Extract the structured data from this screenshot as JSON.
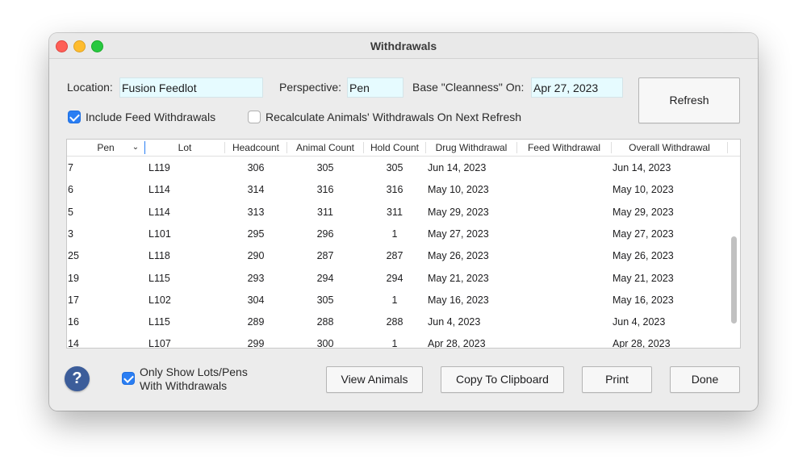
{
  "window": {
    "title": "Withdrawals"
  },
  "filters": {
    "location_label": "Location:",
    "location_value": "Fusion Feedlot",
    "perspective_label": "Perspective:",
    "perspective_value": "Pen",
    "cleanness_label": "Base \"Cleanness\" On:",
    "cleanness_value": "Apr 27, 2023",
    "include_feed_label": "Include Feed Withdrawals",
    "include_feed_checked": true,
    "recalculate_label": "Recalculate Animals' Withdrawals On Next Refresh",
    "recalculate_checked": false,
    "refresh_label": "Refresh"
  },
  "table": {
    "columns": [
      "Pen",
      "Lot",
      "Headcount",
      "Animal Count",
      "Hold Count",
      "Drug Withdrawal",
      "Feed Withdrawal",
      "Overall Withdrawal"
    ],
    "sort_icon": "chevron-down-icon",
    "rows": [
      [
        "7",
        "L119",
        "306",
        "305",
        "305",
        "Jun 14, 2023",
        "",
        "Jun 14, 2023"
      ],
      [
        "6",
        "L114",
        "314",
        "316",
        "316",
        "May 10, 2023",
        "",
        "May 10, 2023"
      ],
      [
        "5",
        "L114",
        "313",
        "311",
        "311",
        "May 29, 2023",
        "",
        "May 29, 2023"
      ],
      [
        "3",
        "L101",
        "295",
        "296",
        "1",
        "May 27, 2023",
        "",
        "May 27, 2023"
      ],
      [
        "25",
        "L118",
        "290",
        "287",
        "287",
        "May 26, 2023",
        "",
        "May 26, 2023"
      ],
      [
        "19",
        "L115",
        "293",
        "294",
        "294",
        "May 21, 2023",
        "",
        "May 21, 2023"
      ],
      [
        "17",
        "L102",
        "304",
        "305",
        "1",
        "May 16, 2023",
        "",
        "May 16, 2023"
      ],
      [
        "16",
        "L115",
        "289",
        "288",
        "288",
        "Jun 4, 2023",
        "",
        "Jun 4, 2023"
      ],
      [
        "14",
        "L107",
        "299",
        "300",
        "1",
        "Apr 28, 2023",
        "",
        "Apr 28, 2023"
      ]
    ]
  },
  "footer": {
    "help_icon": "?",
    "only_show_label_line1": "Only Show Lots/Pens",
    "only_show_label_line2": "With Withdrawals",
    "only_show_checked": true,
    "view_animals_label": "View Animals",
    "copy_label": "Copy To Clipboard",
    "print_label": "Print",
    "done_label": "Done"
  },
  "colors": {
    "accent": "#2a7ef3",
    "field_bg": "#e6fbff",
    "help_bg": "#3c5d9a"
  }
}
